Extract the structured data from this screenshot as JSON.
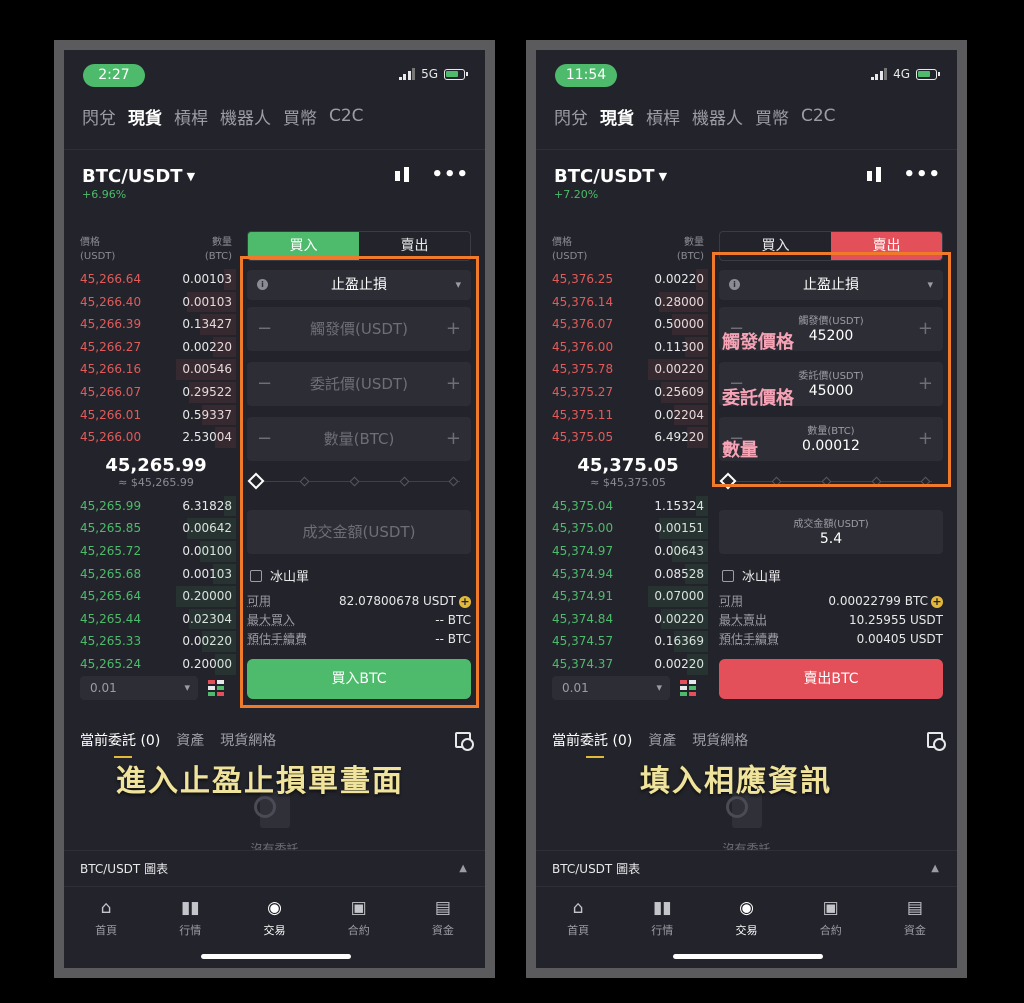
{
  "screens": [
    {
      "time": "2:27",
      "network": "5G",
      "nav": [
        "閃兌",
        "現貨",
        "槓桿",
        "機器人",
        "買幣",
        "C2C"
      ],
      "nav_active": 1,
      "pair": "BTC/USDT",
      "change": "+6.96%",
      "ob_header": {
        "price": "價格",
        "price_unit": "(USDT)",
        "qty": "數量",
        "qty_unit": "(BTC)"
      },
      "asks": [
        {
          "p": "45,266.64",
          "q": "0.00103"
        },
        {
          "p": "45,266.40",
          "q": "0.00103"
        },
        {
          "p": "45,266.39",
          "q": "0.13427"
        },
        {
          "p": "45,266.27",
          "q": "0.00220"
        },
        {
          "p": "45,266.16",
          "q": "0.00546"
        },
        {
          "p": "45,266.07",
          "q": "0.29522"
        },
        {
          "p": "45,266.01",
          "q": "0.59337"
        },
        {
          "p": "45,266.00",
          "q": "2.53004"
        }
      ],
      "mid_price": "45,265.99",
      "mid_fiat": "≈ $45,265.99",
      "bids": [
        {
          "p": "45,265.99",
          "q": "6.31828"
        },
        {
          "p": "45,265.85",
          "q": "0.00642"
        },
        {
          "p": "45,265.72",
          "q": "0.00100"
        },
        {
          "p": "45,265.68",
          "q": "0.00103"
        },
        {
          "p": "45,265.64",
          "q": "0.20000"
        },
        {
          "p": "45,265.44",
          "q": "0.02304"
        },
        {
          "p": "45,265.33",
          "q": "0.00220"
        },
        {
          "p": "45,265.24",
          "q": "0.20000"
        }
      ],
      "depth": "0.01",
      "tab_buy": "買入",
      "tab_sell": "賣出",
      "side": "buy",
      "order_type": "止盈止損",
      "trigger": {
        "placeholder": "觸發價(USDT)",
        "label": "",
        "value": ""
      },
      "limit": {
        "placeholder": "委託價(USDT)",
        "label": "",
        "value": ""
      },
      "amount": {
        "placeholder": "數量(BTC)",
        "label": "",
        "value": ""
      },
      "total": {
        "placeholder": "成交金額(USDT)",
        "label": "",
        "value": ""
      },
      "iceberg": "冰山單",
      "info": [
        {
          "k": "可用",
          "v": "82.07800678 USDT"
        },
        {
          "k": "最大買入",
          "v": "-- BTC"
        },
        {
          "k": "預估手續費",
          "v": "-- BTC"
        }
      ],
      "action": "買入BTC",
      "orders_tabs": [
        "當前委託 (0)",
        "資產",
        "現貨網格"
      ],
      "empty": "沒有委託",
      "chart_label": "BTC/USDT 圖表",
      "tabbar": [
        "首頁",
        "行情",
        "交易",
        "合約",
        "資金"
      ],
      "caption": "進入止盈止損單畫面",
      "pink_labels": []
    },
    {
      "time": "11:54",
      "network": "4G",
      "nav": [
        "閃兌",
        "現貨",
        "槓桿",
        "機器人",
        "買幣",
        "C2C"
      ],
      "nav_active": 1,
      "pair": "BTC/USDT",
      "change": "+7.20%",
      "ob_header": {
        "price": "價格",
        "price_unit": "(USDT)",
        "qty": "數量",
        "qty_unit": "(BTC)"
      },
      "asks": [
        {
          "p": "45,376.25",
          "q": "0.00220"
        },
        {
          "p": "45,376.14",
          "q": "0.28000"
        },
        {
          "p": "45,376.07",
          "q": "0.50000"
        },
        {
          "p": "45,376.00",
          "q": "0.11300"
        },
        {
          "p": "45,375.78",
          "q": "0.00220"
        },
        {
          "p": "45,375.27",
          "q": "0.25609"
        },
        {
          "p": "45,375.11",
          "q": "0.02204"
        },
        {
          "p": "45,375.05",
          "q": "6.49220"
        }
      ],
      "mid_price": "45,375.05",
      "mid_fiat": "≈ $45,375.05",
      "bids": [
        {
          "p": "45,375.04",
          "q": "1.15324"
        },
        {
          "p": "45,375.00",
          "q": "0.00151"
        },
        {
          "p": "45,374.97",
          "q": "0.00643"
        },
        {
          "p": "45,374.94",
          "q": "0.08528"
        },
        {
          "p": "45,374.91",
          "q": "0.07000"
        },
        {
          "p": "45,374.84",
          "q": "0.00220"
        },
        {
          "p": "45,374.57",
          "q": "0.16369"
        },
        {
          "p": "45,374.37",
          "q": "0.00220"
        }
      ],
      "depth": "0.01",
      "tab_buy": "買入",
      "tab_sell": "賣出",
      "side": "sell",
      "order_type": "止盈止損",
      "trigger": {
        "placeholder": "",
        "label": "觸發價(USDT)",
        "value": "45200"
      },
      "limit": {
        "placeholder": "",
        "label": "委託價(USDT)",
        "value": "45000"
      },
      "amount": {
        "placeholder": "",
        "label": "數量(BTC)",
        "value": "0.00012"
      },
      "total": {
        "placeholder": "",
        "label": "成交金額(USDT)",
        "value": "5.4"
      },
      "iceberg": "冰山單",
      "info": [
        {
          "k": "可用",
          "v": "0.00022799 BTC"
        },
        {
          "k": "最大賣出",
          "v": "10.25955 USDT"
        },
        {
          "k": "預估手續費",
          "v": "0.00405 USDT"
        }
      ],
      "action": "賣出BTC",
      "orders_tabs": [
        "當前委託 (0)",
        "資產",
        "現貨網格"
      ],
      "empty": "沒有委託",
      "chart_label": "BTC/USDT 圖表",
      "tabbar": [
        "首頁",
        "行情",
        "交易",
        "合約",
        "資金"
      ],
      "caption": "填入相應資訊",
      "pink_labels": [
        "觸發價格",
        "委託價格",
        "數量"
      ]
    }
  ],
  "colors": {
    "buy": "#4dbb6b",
    "sell": "#e4505a",
    "highlight": "#f07a2a",
    "caption": "#f0e39b",
    "annotation": "#f7a3b6"
  },
  "icons": {
    "home": "home-icon",
    "market": "bar-chart-icon",
    "trade": "trade-icon",
    "futures": "futures-icon",
    "wallet": "wallet-icon"
  }
}
